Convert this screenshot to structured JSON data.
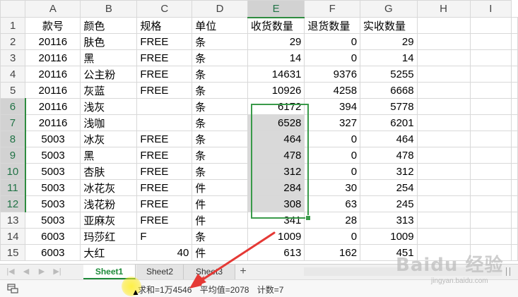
{
  "columns": [
    "A",
    "B",
    "C",
    "D",
    "E",
    "F",
    "G",
    "H",
    "I"
  ],
  "rows": [
    {
      "num": "1",
      "a": "款号",
      "b": "颜色",
      "c": "规格",
      "d": "单位",
      "e": "收货数量",
      "f": "退货数量",
      "g": "实收数量"
    },
    {
      "num": "2",
      "a": "20116",
      "b": "肤色",
      "c": "FREE",
      "d": "条",
      "e": "29",
      "f": "0",
      "g": "29"
    },
    {
      "num": "3",
      "a": "20116",
      "b": "黑",
      "c": "FREE",
      "d": "条",
      "e": "14",
      "f": "0",
      "g": "14"
    },
    {
      "num": "4",
      "a": "20116",
      "b": "公主粉",
      "c": "FREE",
      "d": "条",
      "e": "14631",
      "f": "9376",
      "g": "5255"
    },
    {
      "num": "5",
      "a": "20116",
      "b": "灰蓝",
      "c": "FREE",
      "d": "条",
      "e": "10926",
      "f": "4258",
      "g": "6668"
    },
    {
      "num": "6",
      "a": "20116",
      "b": "浅灰",
      "c": "",
      "d": "条",
      "e": "6172",
      "f": "394",
      "g": "5778"
    },
    {
      "num": "7",
      "a": "20116",
      "b": "浅咖",
      "c": "",
      "d": "条",
      "e": "6528",
      "f": "327",
      "g": "6201"
    },
    {
      "num": "8",
      "a": "5003",
      "b": "冰灰",
      "c": "FREE",
      "d": "条",
      "e": "464",
      "f": "0",
      "g": "464"
    },
    {
      "num": "9",
      "a": "5003",
      "b": "黑",
      "c": "FREE",
      "d": "条",
      "e": "478",
      "f": "0",
      "g": "478"
    },
    {
      "num": "10",
      "a": "5003",
      "b": "杏肤",
      "c": "FREE",
      "d": "条",
      "e": "312",
      "f": "0",
      "g": "312"
    },
    {
      "num": "11",
      "a": "5003",
      "b": "冰花灰",
      "c": "FREE",
      "d": "件",
      "e": "284",
      "f": "30",
      "g": "254"
    },
    {
      "num": "12",
      "a": "5003",
      "b": "浅花粉",
      "c": "FREE",
      "d": "件",
      "e": "308",
      "f": "63",
      "g": "245"
    },
    {
      "num": "13",
      "a": "5003",
      "b": "亚麻灰",
      "c": "FREE",
      "d": "件",
      "e": "341",
      "f": "28",
      "g": "313"
    },
    {
      "num": "14",
      "a": "6003",
      "b": "玛莎红",
      "c": "F",
      "d": "条",
      "e": "1009",
      "f": "0",
      "g": "1009"
    },
    {
      "num": "15",
      "a": "6003",
      "b": "大红",
      "c": "40",
      "d": "件",
      "e": "613",
      "f": "162",
      "g": "451"
    }
  ],
  "sheets": {
    "tab1": "Sheet1",
    "tab2": "Sheet2",
    "tab3": "Sheet3",
    "add": "+"
  },
  "status": {
    "sum": "求和=1万4546",
    "avg": "平均值=2078",
    "count": "计数=7"
  },
  "watermark": {
    "main": "Baidu 经验",
    "sub": "jingyan.baidu.com"
  },
  "colors": {
    "selection": "#3a9a4a",
    "active_tab": "#1e8a3a",
    "arrow": "#e53935"
  },
  "icons": {
    "status": "sheet-icon",
    "cursor": "mouse-pointer-icon"
  }
}
